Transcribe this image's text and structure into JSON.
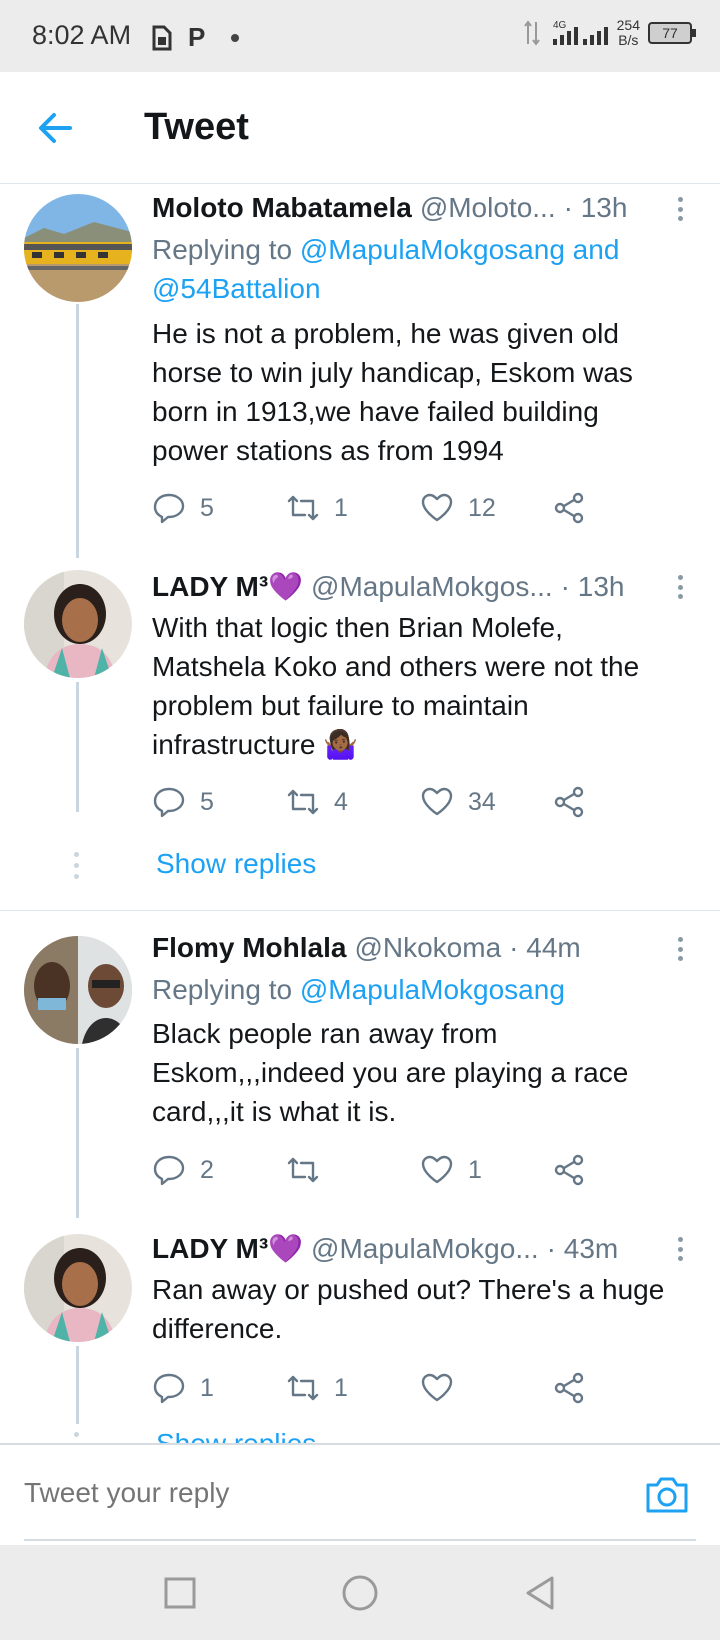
{
  "status_bar": {
    "time": "8:02 AM",
    "p_label": "P",
    "network": "4G",
    "rate_value": "254",
    "rate_unit": "B/s",
    "battery": "77"
  },
  "header": {
    "title": "Tweet"
  },
  "tweets": [
    {
      "name": "Moloto Mabatamela",
      "handle": "@Moloto...",
      "time": "· 13h",
      "replying_prefix": "Replying to",
      "replying_to": "@MapulaMokgosang and",
      "replying_to_2": "@54Battalion",
      "body": "He is not a problem, he was given old horse to win july handicap, Eskom was born in 1913,we have failed building power stations as from 1994",
      "replies": "5",
      "retweets": "1",
      "likes": "12"
    },
    {
      "name": "LADY M³💜",
      "handle": "@MapulaMokgos...",
      "time": "· 13h",
      "body": "With that logic then Brian Molefe, Matshela Koko and others were not the problem but failure to maintain infrastructure 🤷🏾‍♀️",
      "replies": "5",
      "retweets": "4",
      "likes": "34",
      "show_replies": "Show replies"
    },
    {
      "name": "Flomy Mohlala",
      "handle": "@Nkokoma",
      "time": "· 44m",
      "replying_prefix": "Replying to",
      "replying_to": "@MapulaMokgosang",
      "body": "Black people ran away from Eskom,,,indeed you are playing a race card,,,it is what it is.",
      "replies": "2",
      "retweets": "",
      "likes": "1"
    },
    {
      "name": "LADY M³💜",
      "handle": "@MapulaMokgo...",
      "time": "· 43m",
      "body": "Ran away or pushed out? There's a huge difference.",
      "replies": "1",
      "retweets": "1",
      "likes": "",
      "show_replies": "Show replies"
    }
  ],
  "reply_bar": {
    "placeholder": "Tweet your reply"
  },
  "colors": {
    "accent": "#1da1f2",
    "muted": "#657786",
    "text": "#14171a"
  },
  "icons": [
    "back-arrow-icon",
    "reply-icon",
    "retweet-icon",
    "like-icon",
    "share-icon",
    "more-icon",
    "camera-icon",
    "nav-recents-icon",
    "nav-home-icon",
    "nav-back-icon"
  ]
}
